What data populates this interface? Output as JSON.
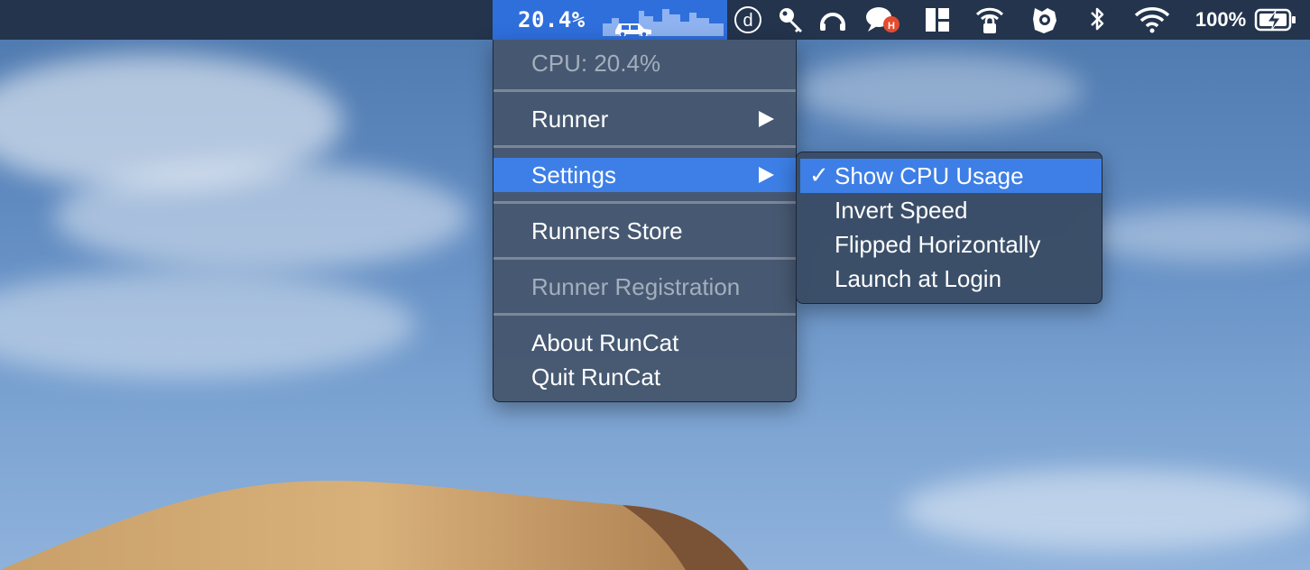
{
  "menubar": {
    "runcat_percent": "20.4%",
    "battery_percent": "100%",
    "tray_icons": [
      "dash-d-icon",
      "key-icon",
      "headphones-icon",
      "chat-bubble-icon",
      "layout-icon",
      "lock-wifi-icon",
      "virus-shield-icon",
      "bluetooth-icon",
      "wifi-icon",
      "battery-charging-icon"
    ]
  },
  "menu": {
    "cpu_label": "CPU: 20.4%",
    "runner": "Runner",
    "settings": "Settings",
    "runners_store": "Runners Store",
    "runner_registration": "Runner Registration",
    "about": "About RunCat",
    "quit": "Quit RunCat"
  },
  "submenu": {
    "checkmark": "✓",
    "items": [
      "Show CPU Usage",
      "Invert Speed",
      "Flipped Horizontally",
      "Launch at Login"
    ]
  },
  "colors": {
    "menubar_bg": "#24344d",
    "highlight": "#3d7fe6",
    "runcat_bg": "#2f6fdc"
  }
}
